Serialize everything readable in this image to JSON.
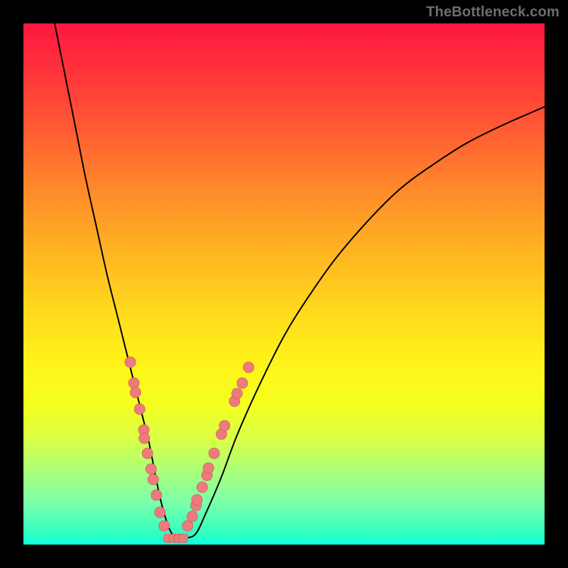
{
  "watermark": "TheBottleneck.com",
  "colors": {
    "curve": "#000000",
    "marker_fill": "#ed7b7d",
    "marker_stroke": "#c55457"
  },
  "chart_data": {
    "type": "line",
    "title": "",
    "xlabel": "",
    "ylabel": "",
    "xlim": [
      0,
      100
    ],
    "ylim": [
      0,
      100
    ],
    "curve": {
      "x": [
        6,
        8,
        10,
        12,
        14,
        16,
        18,
        20,
        21,
        22,
        23,
        24,
        25,
        26,
        27,
        28,
        29,
        30,
        31,
        33,
        35,
        38,
        41,
        45,
        50,
        55,
        60,
        66,
        72,
        78,
        85,
        92,
        100
      ],
      "y": [
        100,
        90,
        80,
        70,
        61,
        52,
        44,
        36,
        32,
        28,
        24,
        20,
        15,
        10,
        6,
        3,
        1.5,
        1.2,
        1.3,
        2,
        6,
        13,
        21,
        30,
        40,
        48,
        55,
        62,
        68,
        72.5,
        77,
        80.5,
        84
      ]
    },
    "series": [
      {
        "name": "left-cluster",
        "marker": "circle",
        "points": [
          {
            "x": 20.5,
            "y": 35
          },
          {
            "x": 21.2,
            "y": 31
          },
          {
            "x": 21.5,
            "y": 29.2
          },
          {
            "x": 22.3,
            "y": 26
          },
          {
            "x": 23.1,
            "y": 22
          },
          {
            "x": 23.2,
            "y": 20.4
          },
          {
            "x": 23.8,
            "y": 17.5
          },
          {
            "x": 24.5,
            "y": 14.5
          },
          {
            "x": 24.9,
            "y": 12.5
          },
          {
            "x": 25.5,
            "y": 9.5
          },
          {
            "x": 26.2,
            "y": 6.2
          },
          {
            "x": 27.0,
            "y": 3.6
          }
        ]
      },
      {
        "name": "right-cluster",
        "marker": "circle",
        "points": [
          {
            "x": 31.5,
            "y": 3.6
          },
          {
            "x": 32.4,
            "y": 5.4
          },
          {
            "x": 33.1,
            "y": 7.5
          },
          {
            "x": 33.3,
            "y": 8.6
          },
          {
            "x": 34.3,
            "y": 11
          },
          {
            "x": 35.2,
            "y": 13.3
          },
          {
            "x": 35.5,
            "y": 14.7
          },
          {
            "x": 36.6,
            "y": 17.5
          },
          {
            "x": 38.0,
            "y": 21.2
          },
          {
            "x": 38.6,
            "y": 22.8
          },
          {
            "x": 40.5,
            "y": 27.5
          },
          {
            "x": 41.0,
            "y": 29.0
          },
          {
            "x": 42.0,
            "y": 31.0
          },
          {
            "x": 43.2,
            "y": 34.0
          }
        ]
      },
      {
        "name": "bottom-track",
        "marker": "rounded-rect",
        "points": [
          {
            "x": 27.8,
            "y": 1.2
          },
          {
            "x": 28.8,
            "y": 1.2
          },
          {
            "x": 29.8,
            "y": 1.2
          },
          {
            "x": 30.7,
            "y": 1.2
          }
        ]
      }
    ]
  }
}
